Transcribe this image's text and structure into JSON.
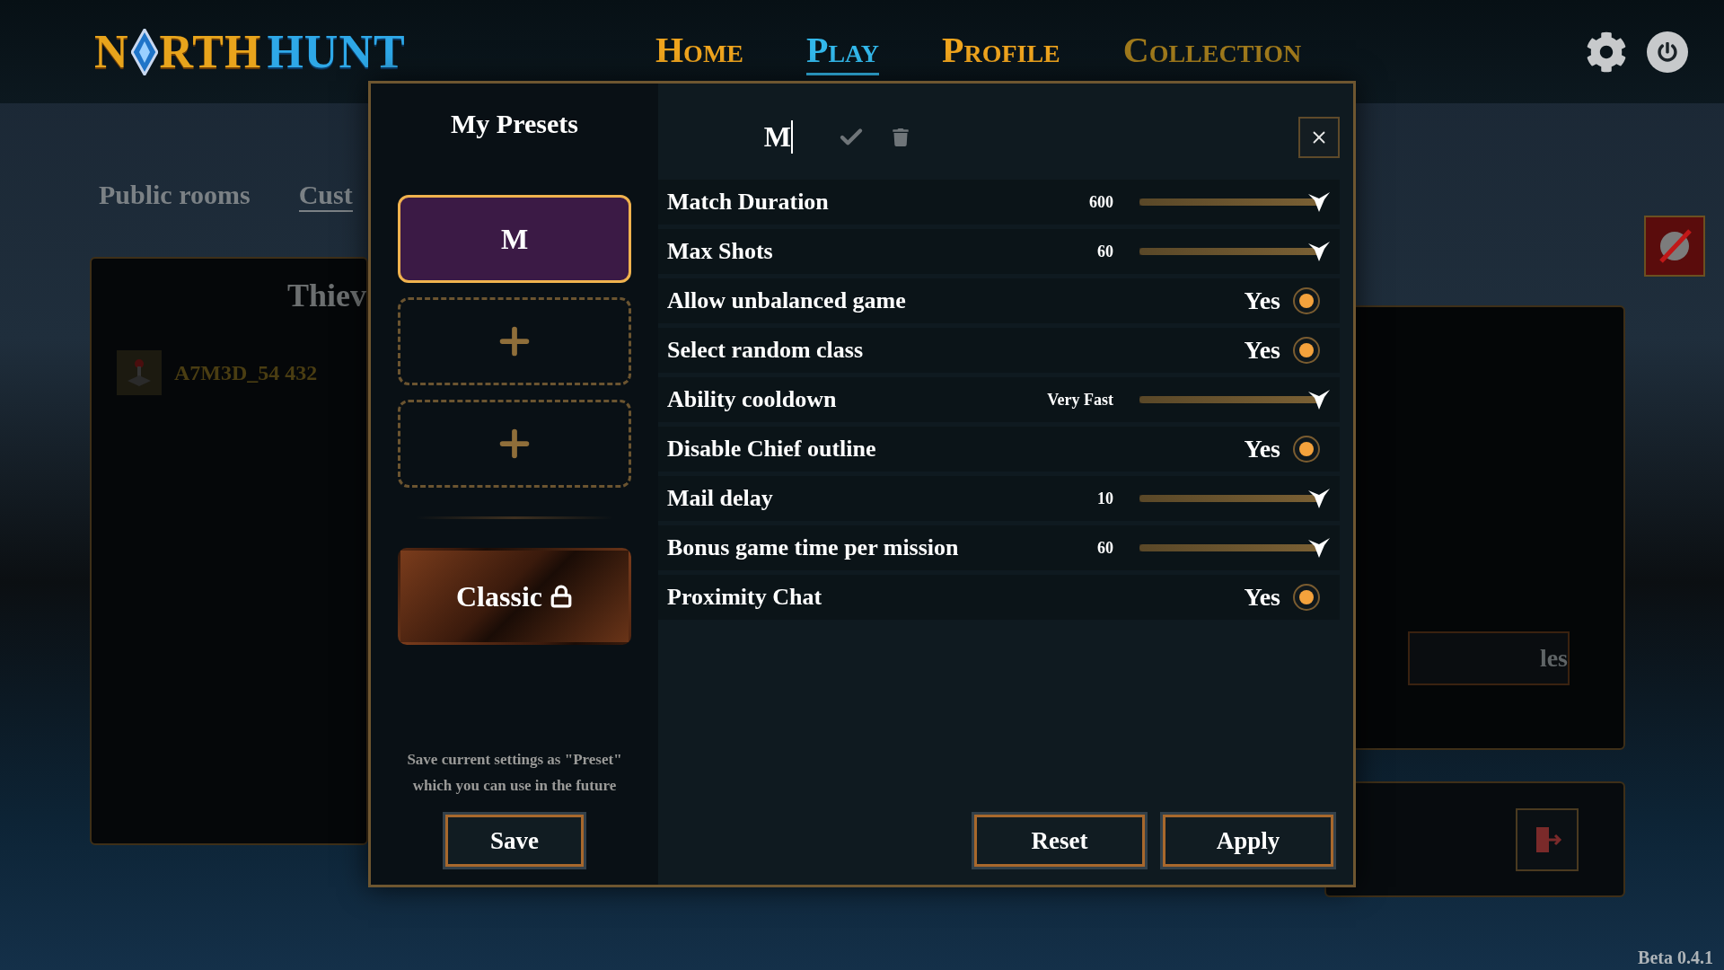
{
  "logo": {
    "part_1": "N",
    "part_2": "RTH",
    "part_3": "HUNT"
  },
  "nav": [
    {
      "label": "Home",
      "selected": false,
      "disabled": false
    },
    {
      "label": "Play",
      "selected": true,
      "disabled": false
    },
    {
      "label": "Profile",
      "selected": false,
      "disabled": false
    },
    {
      "label": "Collection",
      "selected": false,
      "disabled": true
    }
  ],
  "background": {
    "tabs": [
      "Public rooms",
      "Cust"
    ],
    "panel_title": "Thiev",
    "room_name": "A7M3D_54 432",
    "right_button": "les",
    "version": "Beta 0.4.1"
  },
  "presets_dialog": {
    "title": "My Presets",
    "presets": [
      {
        "kind": "preset",
        "label": "M",
        "selected": true
      },
      {
        "kind": "empty",
        "selected": false
      },
      {
        "kind": "empty",
        "selected": false
      },
      {
        "kind": "locked",
        "label": "Classic",
        "selected": false
      }
    ],
    "save_hint": "Save current settings as \"Preset\" which you can use in the future",
    "save_button": "Save",
    "name_value": "M",
    "settings": [
      {
        "kind": "slider",
        "label": "Match Duration",
        "value": "600",
        "level": 1
      },
      {
        "kind": "slider",
        "label": "Max Shots",
        "value": "60",
        "level": 1
      },
      {
        "kind": "toggle",
        "label": "Allow unbalanced game",
        "value": "Yes",
        "on": true
      },
      {
        "kind": "toggle",
        "label": "Select random class",
        "value": "Yes",
        "on": true
      },
      {
        "kind": "slider",
        "label": "Ability cooldown",
        "value": "Very Fast",
        "level": 1
      },
      {
        "kind": "toggle",
        "label": "Disable Chief outline",
        "value": "Yes",
        "on": true
      },
      {
        "kind": "slider",
        "label": "Mail delay",
        "value": "10",
        "level": 1
      },
      {
        "kind": "slider",
        "label": "Bonus game time per mission",
        "value": "60",
        "level": 1
      },
      {
        "kind": "toggle",
        "label": "Proximity Chat",
        "value": "Yes",
        "on": true
      }
    ],
    "buttons": [
      "Reset",
      "Apply"
    ]
  }
}
